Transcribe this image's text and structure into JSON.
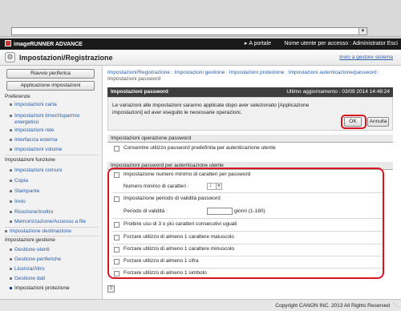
{
  "app": {
    "brand": "imageRUNNER ADVANCE",
    "portal_link": "A portale",
    "user_info": "Nome utente per accesso : Administrator Esci",
    "title": "Impostazioni/Registrazione",
    "manager_link": "Invio a gestore sistema"
  },
  "sidebar": {
    "reset_button": "Riavvio periferica",
    "apply_button": "Applicazione impostazioni",
    "sections": [
      {
        "label": "Preferenze",
        "items": [
          "Impostazioni carta",
          "Impostazioni timer/risparmio energetico",
          "Impostazioni rete",
          "Interfaccia esterna",
          "Impostazioni volume"
        ]
      },
      {
        "label": "Impostazioni funzione",
        "items": [
          "Impostazioni comuni",
          "Copia",
          "Stampante",
          "Invio",
          "Ricezione/Inoltro",
          "Memorizzazione/Accesso a file"
        ]
      },
      {
        "label": "Impostazione destinazione",
        "items": []
      },
      {
        "label": "Impostazioni gestione",
        "items": [
          "Gestione utenti",
          "Gestione periferiche",
          "Licenza/Altro",
          "Gestione dati",
          "Impostazioni protezione"
        ]
      }
    ]
  },
  "main": {
    "breadcrumb_links": "Impostazioni/Registrazione : Impostazioni gestione : Impostazioni protezione : Impostazioni autenticazione/password :",
    "breadcrumb_current": "Impostazioni password",
    "panel_title": "Impostazioni password",
    "last_update": "Ultimo aggiornamento : 03/09 2014 14:48:24",
    "notice": "Le variazioni alle impostazioni saranno applicate dopo aver selezionato [Applicazione impostazioni] ed aver eseguito le necessarie operazioni.",
    "ok_label": "OK",
    "cancel_label": "Annulla",
    "section1_title": "Impostazioni operazione password",
    "section1_option": "Consentire utilizzo password predefinita per autenticazione utente",
    "section2_title": "Impostazioni password per autenticazione utente",
    "min_chars_option": "Impostazione numero minimo di caratteri per password",
    "min_chars_label": "Numero minimo di caratteri :",
    "min_chars_value": "1",
    "validity_option": "Impostazione periodo di validità password",
    "validity_label": "Periodo di validità :",
    "validity_unit": "giorni (1-180)",
    "repeat_option": "Proibire uso di 3 o più caratteri consecutivi uguali",
    "upper_option": "Forzare utilizzo di almeno 1 carattere maiuscolo",
    "lower_option": "Forzare utilizzo di almeno 1 carattere minuscolo",
    "digit_option": "Forzare utilizzo di almeno 1 cifra",
    "symbol_option": "Forzare utilizzo di almeno 1 simbolo"
  },
  "footer": {
    "copyright": "Copyright CANON INC. 2013 All Rights Reserved"
  },
  "colors": {
    "highlight_red": "#d8141e",
    "link_blue": "#2a5ca8",
    "header_dark": "#1a1a1a"
  }
}
